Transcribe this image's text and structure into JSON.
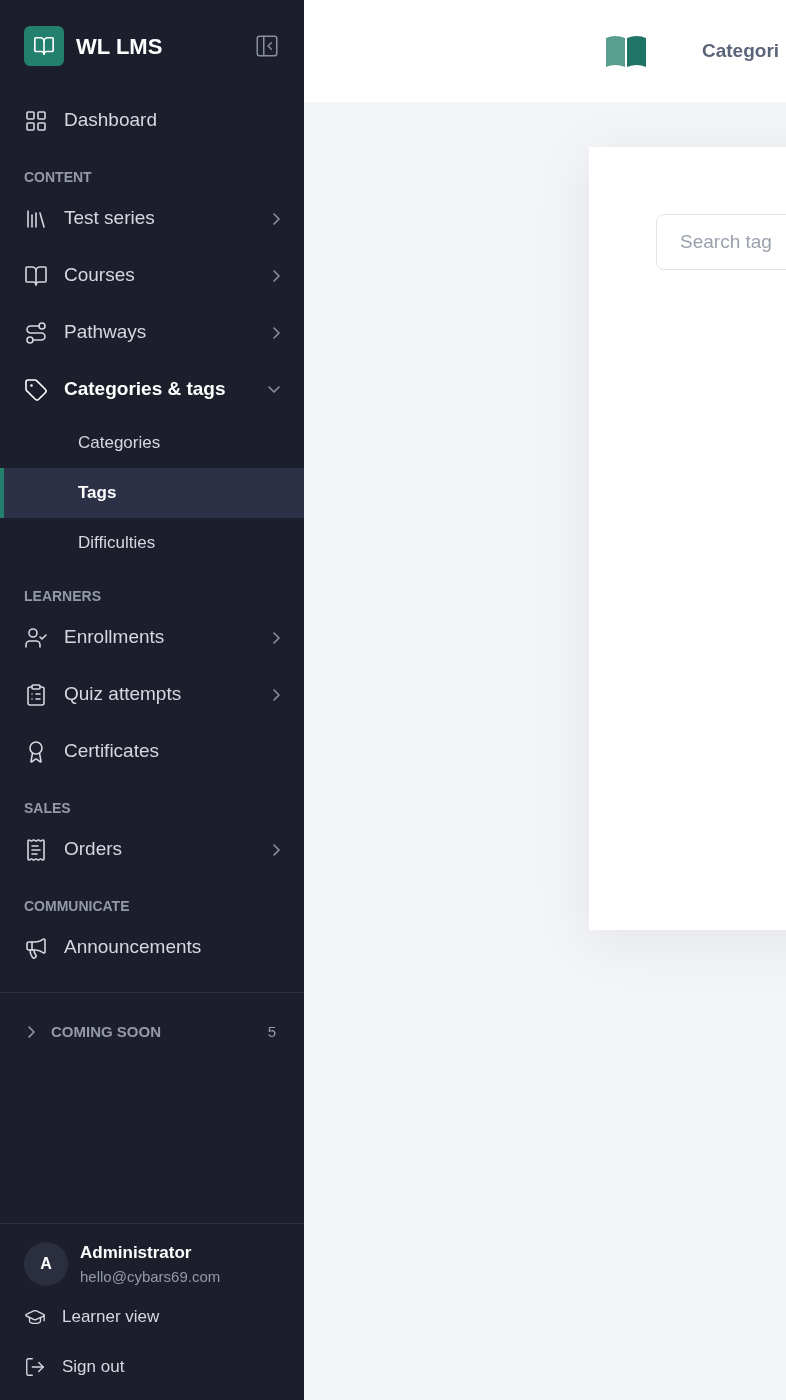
{
  "sidebar": {
    "brand": "WL LMS",
    "top": [
      {
        "label": "Dashboard",
        "selected": false
      }
    ],
    "sections": [
      {
        "heading": "CONTENT",
        "items": [
          {
            "label": "Test series",
            "kind": "group",
            "expanded": false,
            "selected": false
          },
          {
            "label": "Courses",
            "kind": "group",
            "expanded": false,
            "selected": false
          },
          {
            "label": "Pathways",
            "kind": "group",
            "expanded": false,
            "selected": false
          },
          {
            "label": "Categories & tags",
            "kind": "group",
            "expanded": true,
            "selected": false,
            "children": [
              {
                "label": "Categories",
                "selected": false
              },
              {
                "label": "Tags",
                "selected": true
              },
              {
                "label": "Difficulties",
                "selected": false
              }
            ]
          }
        ]
      },
      {
        "heading": "LEARNERS",
        "items": [
          {
            "label": "Enrollments",
            "kind": "group",
            "expanded": false,
            "selected": false
          },
          {
            "label": "Quiz attempts",
            "kind": "group",
            "expanded": false,
            "selected": false
          },
          {
            "label": "Certificates",
            "kind": "link",
            "selected": false
          }
        ]
      },
      {
        "heading": "SALES",
        "items": [
          {
            "label": "Orders",
            "kind": "group",
            "expanded": false,
            "selected": false
          }
        ]
      },
      {
        "heading": "COMMUNICATE",
        "items": [
          {
            "label": "Announcements",
            "kind": "link",
            "selected": false
          }
        ]
      }
    ],
    "coming_soon": {
      "label": "COMING SOON",
      "count": "5",
      "expanded": false
    },
    "user": {
      "initial": "A",
      "name": "Administrator",
      "email": "hello@cybars69.com"
    },
    "footer": [
      "Learner view",
      "Sign out"
    ]
  },
  "header": {
    "title": "Categori"
  },
  "search": {
    "placeholder": "Search tag"
  }
}
